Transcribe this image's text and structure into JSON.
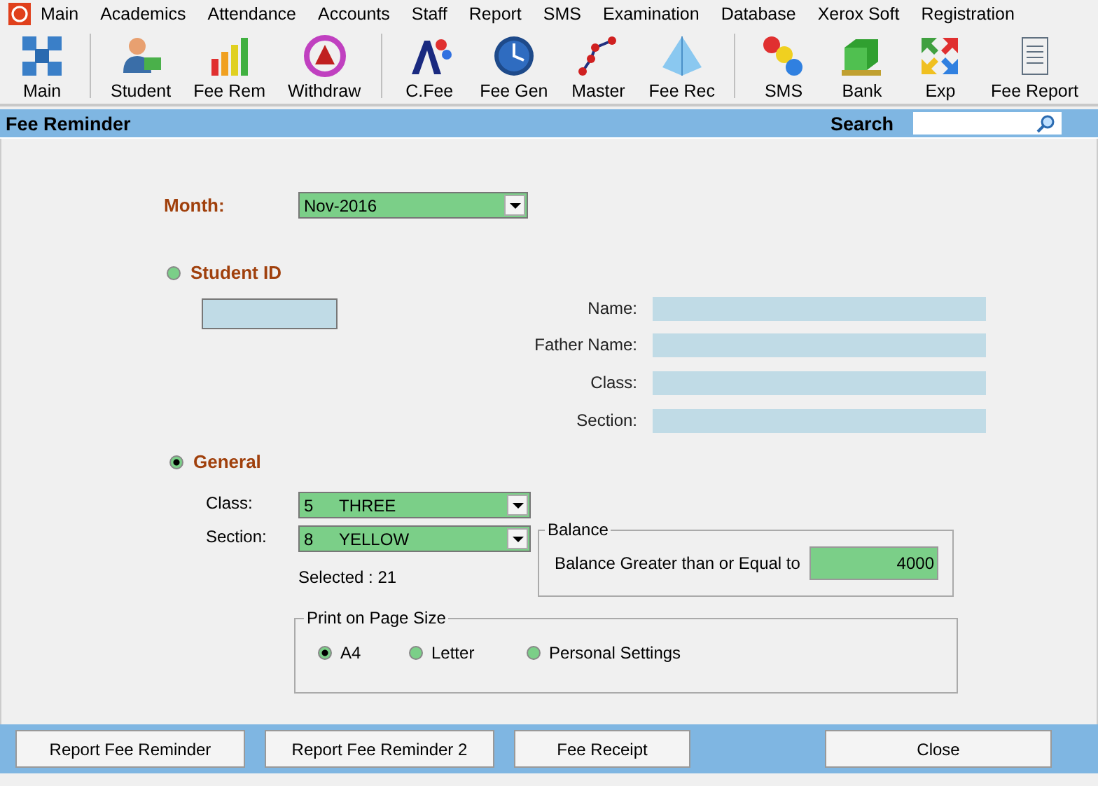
{
  "menu": [
    "Main",
    "Academics",
    "Attendance",
    "Accounts",
    "Staff",
    "Report",
    "SMS",
    "Examination",
    "Database",
    "Xerox Soft",
    "Registration"
  ],
  "toolbar": [
    [
      {
        "label": "Main"
      }
    ],
    [
      {
        "label": "Student"
      },
      {
        "label": "Fee Rem"
      },
      {
        "label": "Withdraw"
      }
    ],
    [
      {
        "label": "C.Fee"
      },
      {
        "label": "Fee Gen"
      },
      {
        "label": "Master"
      },
      {
        "label": "Fee Rec"
      }
    ],
    [
      {
        "label": "SMS"
      },
      {
        "label": "Bank"
      },
      {
        "label": "Exp"
      },
      {
        "label": "Fee Report"
      }
    ]
  ],
  "header": {
    "title": "Fee Reminder",
    "search_label": "Search"
  },
  "month": {
    "label": "Month:",
    "value": "Nov-2016"
  },
  "student_id": {
    "label": "Student ID",
    "selected": false,
    "fields": [
      "Name:",
      "Father Name:",
      "Class:",
      "Section:"
    ]
  },
  "general": {
    "label": "General",
    "selected": true,
    "class": {
      "label": "Class:",
      "code": "5",
      "value": "THREE"
    },
    "section": {
      "label": "Section:",
      "code": "8",
      "value": "YELLOW"
    },
    "selected_count": "Selected : 21"
  },
  "balance": {
    "legend": "Balance",
    "label": "Balance Greater than or Equal to",
    "value": "4000"
  },
  "page_size": {
    "legend": "Print on Page Size",
    "options": [
      {
        "label": "A4",
        "selected": true
      },
      {
        "label": "Letter",
        "selected": false
      },
      {
        "label": "Personal Settings",
        "selected": false
      }
    ]
  },
  "buttons": [
    "Report Fee Reminder",
    "Report Fee Reminder 2",
    "Fee Receipt",
    "Close"
  ]
}
